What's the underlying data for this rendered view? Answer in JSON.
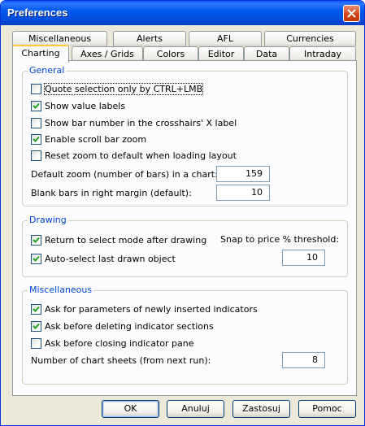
{
  "window": {
    "title": "Preferences"
  },
  "tabs_row1": [
    "Miscellaneous",
    "Alerts",
    "AFL",
    "Currencies"
  ],
  "tabs_row2": [
    "Charting",
    "Axes / Grids",
    "Colors",
    "Editor",
    "Data",
    "Intraday"
  ],
  "active_tab": "Charting",
  "general": {
    "title": "General",
    "checkboxes": [
      {
        "label": "Quote selection only by CTRL+LMB",
        "checked": false
      },
      {
        "label": "Show value labels",
        "checked": true
      },
      {
        "label": "Show bar number in the crosshairs' X label",
        "checked": false
      },
      {
        "label": "Enable scroll bar zoom",
        "checked": true
      },
      {
        "label": "Reset zoom to default when loading layout",
        "checked": false
      }
    ],
    "default_zoom_label": "Default zoom (number of bars) in a chart:",
    "default_zoom_value": "159",
    "blank_bars_label": "Blank bars in right margin (default):",
    "blank_bars_value": "10"
  },
  "drawing": {
    "title": "Drawing",
    "checkboxes": [
      {
        "label": "Return to select mode after drawing",
        "checked": true
      },
      {
        "label": "Auto-select last drawn object",
        "checked": true
      }
    ],
    "snap_label": "Snap to price % threshold:",
    "snap_value": "10"
  },
  "misc": {
    "title": "Miscellaneous",
    "checkboxes": [
      {
        "label": "Ask for parameters of newly inserted indicators",
        "checked": true
      },
      {
        "label": "Ask before deleting indicator sections",
        "checked": true
      },
      {
        "label": "Ask before closing indicator pane",
        "checked": false
      }
    ],
    "sheets_label": "Number of chart sheets (from next run):",
    "sheets_value": "8"
  },
  "buttons": {
    "ok": "OK",
    "cancel": "Anuluj",
    "apply": "Zastosuj",
    "help": "Pomoc"
  }
}
